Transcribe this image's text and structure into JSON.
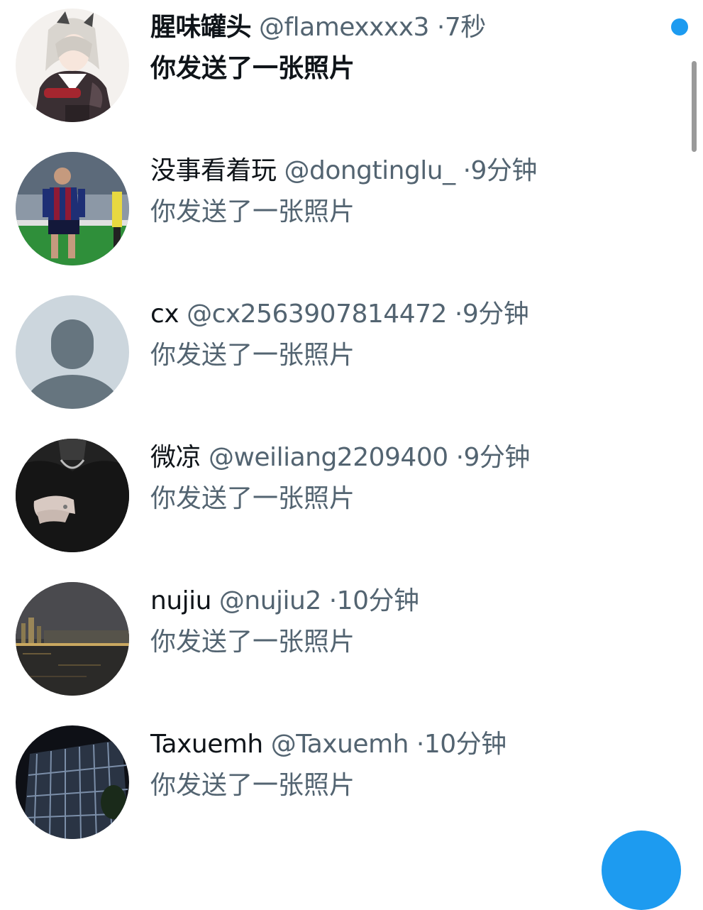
{
  "conversations": [
    {
      "display_name": "腥味罐头",
      "handle": "@flamexxxx3",
      "separator": "·",
      "time": "7秒",
      "preview": "你发送了一张照片",
      "unread": true,
      "avatar": "anime-character-avatar"
    },
    {
      "display_name": "没事看着玩",
      "handle": "@dongtinglu_",
      "separator": "·",
      "time": "9分钟",
      "preview": "你发送了一张照片",
      "unread": false,
      "avatar": "football-player-avatar"
    },
    {
      "display_name": "cx",
      "handle": "@cx2563907814472",
      "separator": "·",
      "time": "9分钟",
      "preview": "你发送了一张照片",
      "unread": false,
      "avatar": "default-profile-avatar"
    },
    {
      "display_name": "微凉",
      "handle": "@weiliang2209400",
      "separator": "·",
      "time": "9分钟",
      "preview": "你发送了一张照片",
      "unread": false,
      "avatar": "dark-clothing-hand-avatar"
    },
    {
      "display_name": "nujiu",
      "handle": "@nujiu2",
      "separator": "·",
      "time": "10分钟",
      "preview": "你发送了一张照片",
      "unread": false,
      "avatar": "night-river-city-avatar"
    },
    {
      "display_name": "Taxuemh",
      "handle": "@Taxuemh",
      "separator": "·",
      "time": "10分钟",
      "preview": "你发送了一张照片",
      "unread": false,
      "avatar": "night-building-avatar"
    }
  ],
  "colors": {
    "accent": "#1d9bf0",
    "primary_text": "#0f1419",
    "secondary_text": "#536471",
    "background": "#ffffff"
  }
}
